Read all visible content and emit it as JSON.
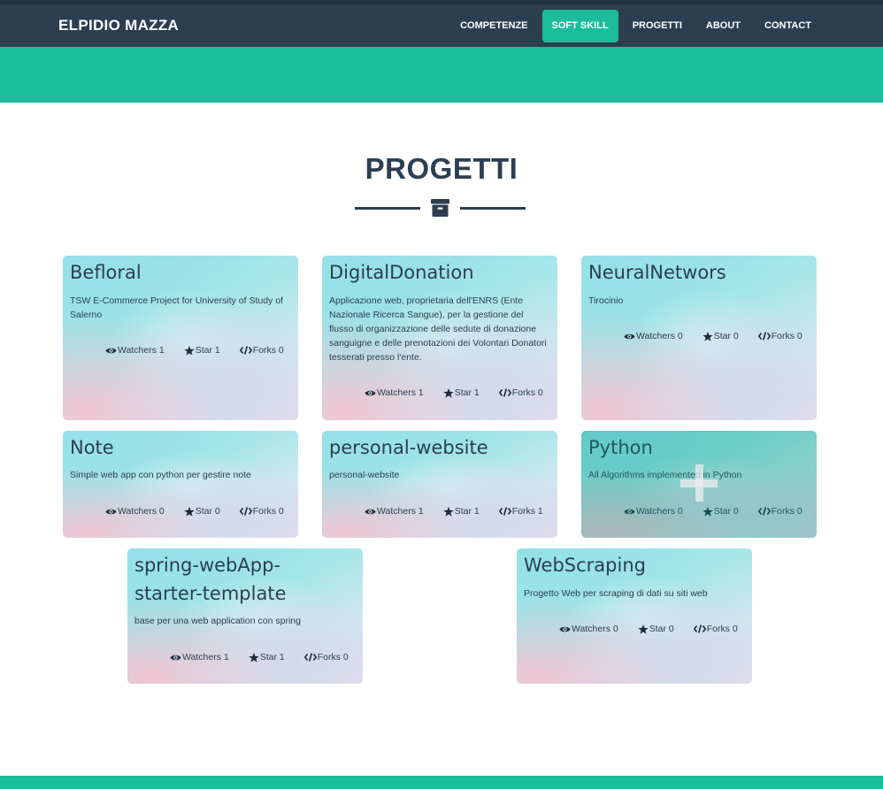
{
  "navbar": {
    "brand": "ELPIDIO MAZZA",
    "items": [
      {
        "label": "COMPETENZE"
      },
      {
        "label": "SOFT SKILL"
      },
      {
        "label": "PROGETTI"
      },
      {
        "label": "ABOUT"
      },
      {
        "label": "CONTACT"
      }
    ],
    "active_item": "SOFT SKILL"
  },
  "section": {
    "title": "PROGETTI",
    "divider_icon": "archive-icon"
  },
  "projects": [
    {
      "name": "Befloral",
      "description": "TSW E-Commerce Project for University of Study of Salerno",
      "watchers": "Watchers 1",
      "stars": "Star 1",
      "forks": "Forks 0"
    },
    {
      "name": "DigitalDonation",
      "description": "Applicazione web, proprietaria dell'ENRS (Ente Nazionale Ricerca Sangue), per la gestione del flusso di organizzazione delle sedute di donazione sanguigne e delle prenotazioni dei Volontari Donatori tesserati presso l'ente.",
      "watchers": "Watchers 1",
      "stars": "Star 1",
      "forks": "Forks 0"
    },
    {
      "name": "NeuralNetwors",
      "description": "Tirocinio",
      "watchers": "Watchers 0",
      "stars": "Star 0",
      "forks": "Forks 0"
    },
    {
      "name": "Note",
      "description": "Simple web app con python per gestire note",
      "watchers": "Watchers 0",
      "stars": "Star 0",
      "forks": "Forks 0"
    },
    {
      "name": "personal-website",
      "description": "personal-website",
      "watchers": "Watchers 1",
      "stars": "Star 1",
      "forks": "Forks 1"
    },
    {
      "name": "Python",
      "description": "All Algorithms implemented in Python",
      "watchers": "Watchers 0",
      "stars": "Star 0",
      "forks": "Forks 0"
    },
    {
      "name": "spring-webApp-starter-template",
      "description": "base per una web application con spring",
      "watchers": "Watchers 1",
      "stars": "Star 1",
      "forks": "Forks 0"
    },
    {
      "name": "WebScraping",
      "description": "Progetto Web per scraping di dati su siti web",
      "watchers": "Watchers 0",
      "stars": "Star 0",
      "forks": "Forks 0"
    }
  ],
  "hovered_project": "Python",
  "icons": {
    "watchers": "eye-icon",
    "stars": "star-icon",
    "forks": "code-icon",
    "hover_overlay": "plus-icon"
  },
  "colors": {
    "primary": "#2c3e50",
    "accent": "#1abc9c"
  }
}
